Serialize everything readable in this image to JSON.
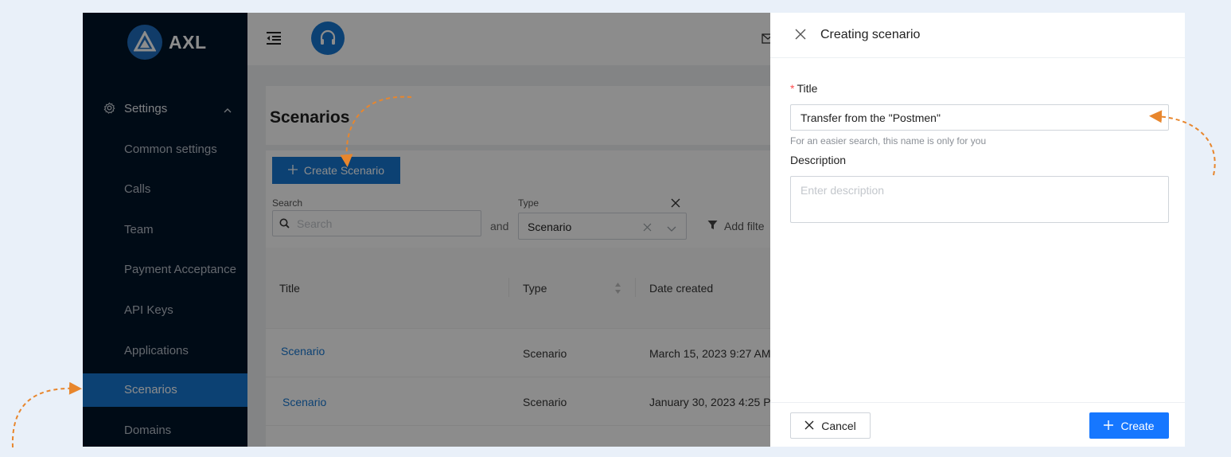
{
  "app": {
    "logo_text": "AXL"
  },
  "sidebar": {
    "group_label": "Settings",
    "items": [
      {
        "label": "Common settings"
      },
      {
        "label": "Calls"
      },
      {
        "label": "Team"
      },
      {
        "label": "Payment Acceptance"
      },
      {
        "label": "API Keys"
      },
      {
        "label": "Applications"
      },
      {
        "label": "Scenarios",
        "active": true
      },
      {
        "label": "Domains"
      }
    ]
  },
  "page": {
    "title": "Scenarios",
    "create_button": "Create Scenario",
    "filters": {
      "search_label": "Search",
      "search_placeholder": "Search",
      "and_label": "and",
      "type_label": "Type",
      "type_value": "Scenario",
      "add_filter_label": "Add filte"
    },
    "table": {
      "columns": [
        "Title",
        "Type",
        "Date created"
      ],
      "rows": [
        {
          "title": "Scenario",
          "type": "Scenario",
          "date": "March 15, 2023 9:27 AM"
        },
        {
          "title": "Scenario",
          "type": "Scenario",
          "date": "January 30, 2023 4:25 P"
        }
      ]
    }
  },
  "drawer": {
    "title": "Creating scenario",
    "title_field": {
      "required_mark": "*",
      "label": "Title",
      "value": "Transfer from the \"Postmen\"",
      "hint": "For an easier search, this name is only for you"
    },
    "description_field": {
      "label": "Description",
      "placeholder": "Enter description"
    },
    "cancel_label": "Cancel",
    "create_label": "Create"
  },
  "colors": {
    "primary": "#1677d2",
    "sidebar_bg": "#001529",
    "annotation": "#e8862d",
    "required": "#ff4d4f"
  }
}
